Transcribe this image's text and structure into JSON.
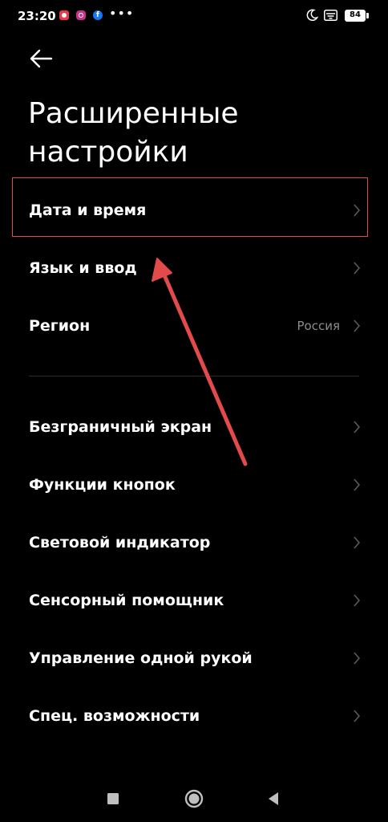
{
  "status_bar": {
    "time": "23:20",
    "dots": "•••",
    "battery": "84",
    "notification_colors": [
      "#e8394a",
      "#c13584",
      "#1877f2"
    ]
  },
  "header": {
    "title": "Расширенные настройки"
  },
  "items": [
    {
      "label": "Дата и время",
      "value": ""
    },
    {
      "label": "Язык и ввод",
      "value": ""
    },
    {
      "label": "Регион",
      "value": "Россия"
    },
    {
      "label": "Безграничный экран",
      "value": ""
    },
    {
      "label": "Функции кнопок",
      "value": ""
    },
    {
      "label": "Световой индикатор",
      "value": ""
    },
    {
      "label": "Сенсорный помощник",
      "value": ""
    },
    {
      "label": "Управление одной рукой",
      "value": ""
    },
    {
      "label": "Спец. возможности",
      "value": ""
    }
  ],
  "colors": {
    "background": "#000000",
    "text": "#ffffff",
    "secondary_text": "#8c8c8c",
    "chevron": "#5a5a5a",
    "annotation": "#e34a4a"
  },
  "icons": {
    "back": "arrow-left-icon",
    "chevron": "chevron-right-icon",
    "nav_recents": "square-icon",
    "nav_home": "circle-icon",
    "nav_back": "triangle-left-icon"
  }
}
